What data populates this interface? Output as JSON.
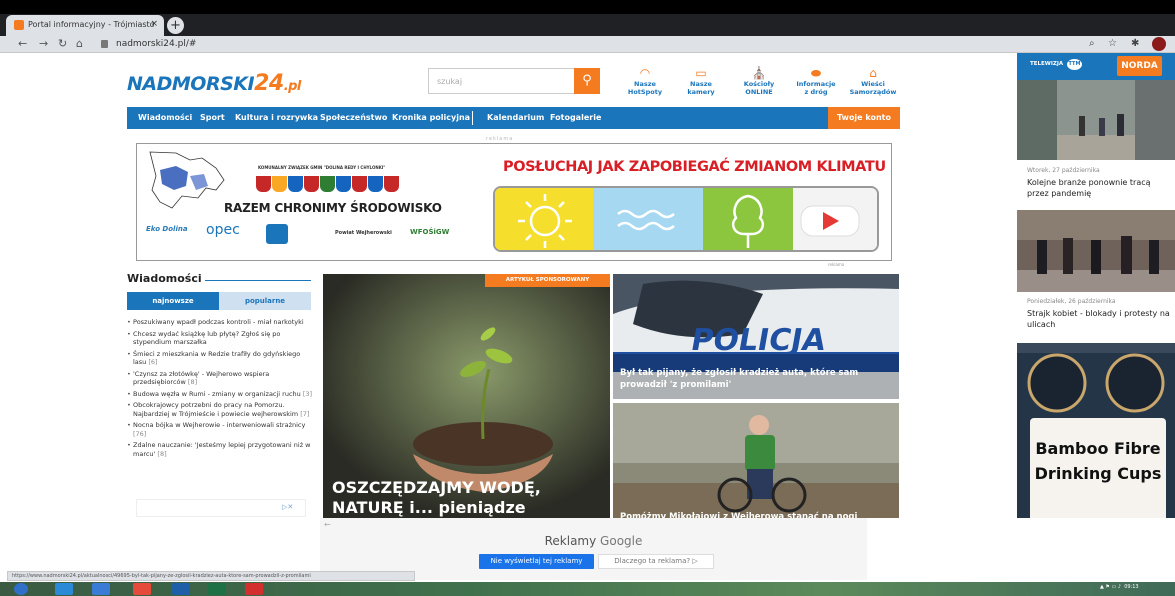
{
  "browser": {
    "tab_title": "Portal informacyjny - Trójmiasto",
    "tab_close": "×",
    "new_tab": "+",
    "url": "nadmorski24.pl/#",
    "status_url": "https://www.nadmorski24.pl/aktualnosci/49695-byl-tak-pijany-ze-zglosil-kradziez-auta-ktore-sam-prowadzil-z-promilami"
  },
  "site": {
    "logo_n": "N",
    "logo_main": "ADMORSKI",
    "logo_24": "24",
    "logo_pl": ".pl",
    "search_placeholder": "szukaj",
    "header_icons": [
      {
        "icon": "wifi-icon",
        "l1": "Nasze",
        "l2": "HotSpoty"
      },
      {
        "icon": "camera-icon",
        "l1": "Nasze",
        "l2": "kamery"
      },
      {
        "icon": "church-icon",
        "l1": "Kościoły",
        "l2": "ONLINE"
      },
      {
        "icon": "car-icon",
        "l1": "Informacje",
        "l2": "z dróg"
      },
      {
        "icon": "town-hall-icon",
        "l1": "Wieści",
        "l2": "Samorządów"
      }
    ],
    "nav": [
      "Wiadomości",
      "Sport",
      "Kultura i rozrywka",
      "Społeczeństwo",
      "Kronika policyjna",
      "Kalendarium",
      "Fotogalerie"
    ],
    "account": "Twoje konto",
    "reklama_tag": "reklama"
  },
  "banner": {
    "top_text": "KOMUNALNY ZWIĄZEK GMIN \"DOLINA REDY I CHYLONKI\"",
    "main_text": "RAZEM CHRONIMY ŚRODOWISKO",
    "climate_text": "POSŁUCHAJ JAK ZAPOBIEGAĆ ZMIANOM KLIMATU",
    "logos": [
      "Eko Dolina",
      "opec",
      "Powiat Wejherowski",
      "WFOŚiGW"
    ],
    "small": "reklama"
  },
  "news": {
    "title": "Wiadomości",
    "tab_new": "najnowsze",
    "tab_popular": "popularne",
    "items": [
      {
        "text": "Poszukiwany wpadł podczas kontroli - miał narkotyki",
        "count": ""
      },
      {
        "text": "Chcesz wydać książkę lub płytę? Zgłoś się po stypendium marszałka",
        "count": ""
      },
      {
        "text": "Śmieci z mieszkania w Redzie trafiły do gdyńskiego lasu",
        "count": "[6]"
      },
      {
        "text": "'Czynsz za złotówkę' - Wejherowo wspiera przedsiębiorców",
        "count": "[8]"
      },
      {
        "text": "Budowa węzła w Rumi - zmiany w organizacji ruchu",
        "count": "[3]"
      },
      {
        "text": "Obcokrajowcy potrzebni do pracy na Pomorzu. Najbardziej w Trójmieście i powiecie wejherowskim",
        "count": "[7]"
      },
      {
        "text": "Nocna bójka w Wejherowie - interweniowali strażnicy",
        "count": "[76]"
      },
      {
        "text": "Zdalne nauczanie: 'Jesteśmy lepiej przygotowani niż w marcu'",
        "count": "[8]"
      }
    ],
    "ad_x": "▷✕"
  },
  "articles": {
    "sponsored": "ARTYKUŁ SPONSOROWANY",
    "main_title": "OSZCZĘDZAJMY WODĘ, NATURĘ i... pieniądze",
    "second_title": "Był tak pijany, że zgłosił kradzież auta, które sam prowadził 'z promilami'",
    "police_text": "POLICJA",
    "third_title": "Pomóżmy Mikołajowi z Wejherowa stanąć na nogi"
  },
  "right": {
    "ttv": "TELEWIZJA",
    "ttv_badge": "TTM",
    "norda": "NORDA",
    "date1": "Wtorek, 27 października",
    "title1": "Kolejne branże ponownie tracą przez pandemię",
    "date2": "Poniedziałek, 26 października",
    "title2": "Strajk kobiet - blokady i protesty na ulicach",
    "ad_text": "Bamboo Fibre Drinking Cups"
  },
  "google_ad": {
    "back": "←",
    "label": "Reklamy",
    "brand": "Google",
    "no_show": "Nie wyświetlaj tej reklamy",
    "why": "Dlaczego ta reklama? ▷"
  },
  "taskbar": {
    "time": "09:13"
  }
}
